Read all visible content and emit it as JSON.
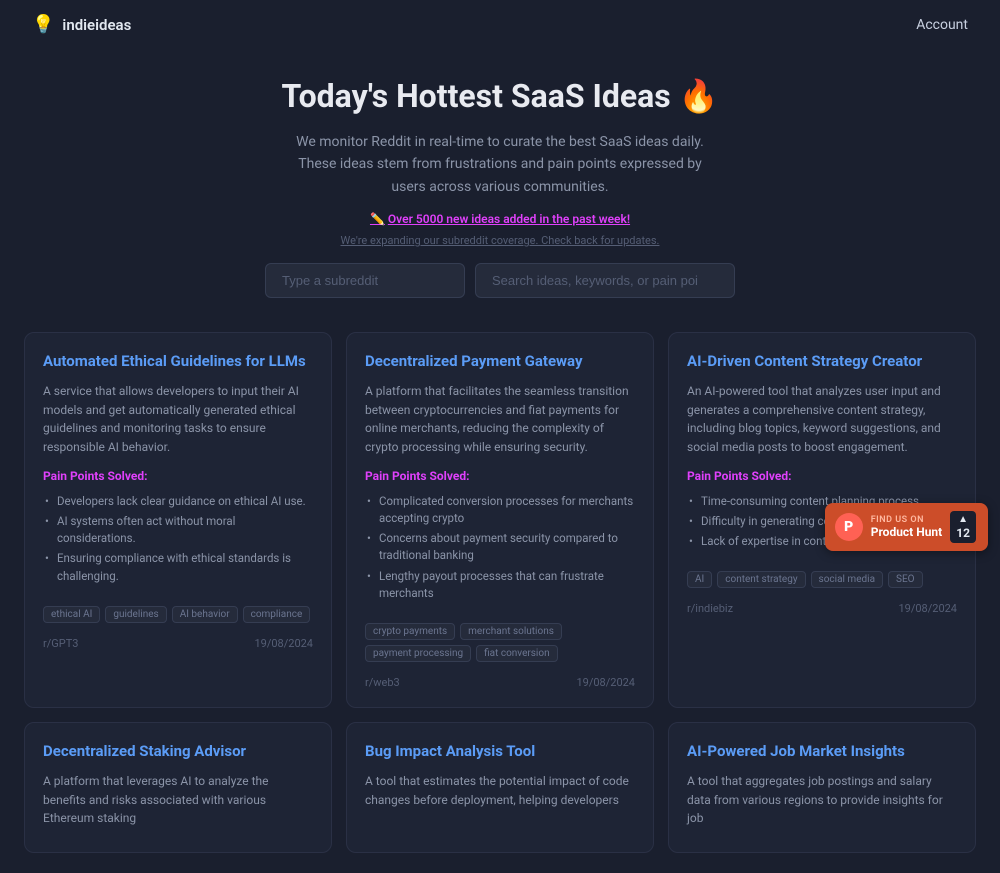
{
  "nav": {
    "logo_icon": "💡",
    "logo_text": "indieideas",
    "account_label": "Account"
  },
  "hero": {
    "title": "Today's Hottest SaaS Ideas 🔥",
    "subtitle": "We monitor Reddit in real-time to curate the best SaaS ideas daily. These ideas stem from frustrations and pain points expressed by users across various communities.",
    "badge_icon": "✏️",
    "badge_text": "Over 5000 new ideas added in the past week!",
    "subtext": "We're expanding our subreddit coverage. Check back for updates.",
    "subreddit_placeholder": "Type a subreddit",
    "search_placeholder": "Search ideas, keywords, or pain poi"
  },
  "cards": [
    {
      "title": "Automated Ethical Guidelines for LLMs",
      "desc": "A service that allows developers to input their AI models and get automatically generated ethical guidelines and monitoring tasks to ensure responsible AI behavior.",
      "pain_points_label": "Pain Points Solved:",
      "pain_points": [
        "Developers lack clear guidance on ethical AI use.",
        "AI systems often act without moral considerations.",
        "Ensuring compliance with ethical standards is challenging."
      ],
      "tags": [
        "ethical AI",
        "guidelines",
        "AI behavior",
        "compliance"
      ],
      "subreddit": "r/GPT3",
      "date": "19/08/2024"
    },
    {
      "title": "Decentralized Payment Gateway",
      "desc": "A platform that facilitates the seamless transition between cryptocurrencies and fiat payments for online merchants, reducing the complexity of crypto processing while ensuring security.",
      "pain_points_label": "Pain Points Solved:",
      "pain_points": [
        "Complicated conversion processes for merchants accepting crypto",
        "Concerns about payment security compared to traditional banking",
        "Lengthy payout processes that can frustrate merchants"
      ],
      "tags": [
        "crypto payments",
        "merchant solutions",
        "payment processing",
        "fiat conversion"
      ],
      "subreddit": "r/web3",
      "date": "19/08/2024"
    },
    {
      "title": "AI-Driven Content Strategy Creator",
      "desc": "An AI-powered tool that analyzes user input and generates a comprehensive content strategy, including blog topics, keyword suggestions, and social media posts to boost engagement.",
      "pain_points_label": "Pain Points Solved:",
      "pain_points": [
        "Time-consuming content planning process",
        "Difficulty in generating consistent content ideas",
        "Lack of expertise in content strategy development"
      ],
      "tags": [
        "AI",
        "content strategy",
        "social media",
        "SEO"
      ],
      "subreddit": "r/indiebiz",
      "date": "19/08/2024"
    },
    {
      "title": "Decentralized Staking Advisor",
      "desc": "A platform that leverages AI to analyze the benefits and risks associated with various Ethereum staking",
      "pain_points_label": "",
      "pain_points": [],
      "tags": [],
      "subreddit": "",
      "date": ""
    },
    {
      "title": "Bug Impact Analysis Tool",
      "desc": "A tool that estimates the potential impact of code changes before deployment, helping developers",
      "pain_points_label": "",
      "pain_points": [],
      "tags": [],
      "subreddit": "",
      "date": ""
    },
    {
      "title": "AI-Powered Job Market Insights",
      "desc": "A tool that aggregates job postings and salary data from various regions to provide insights for job",
      "pain_points_label": "",
      "pain_points": [],
      "tags": [],
      "subreddit": "",
      "date": ""
    }
  ],
  "ph": {
    "find_us": "FIND US ON",
    "name": "Product Hunt",
    "count": "12",
    "arrow": "▲"
  }
}
